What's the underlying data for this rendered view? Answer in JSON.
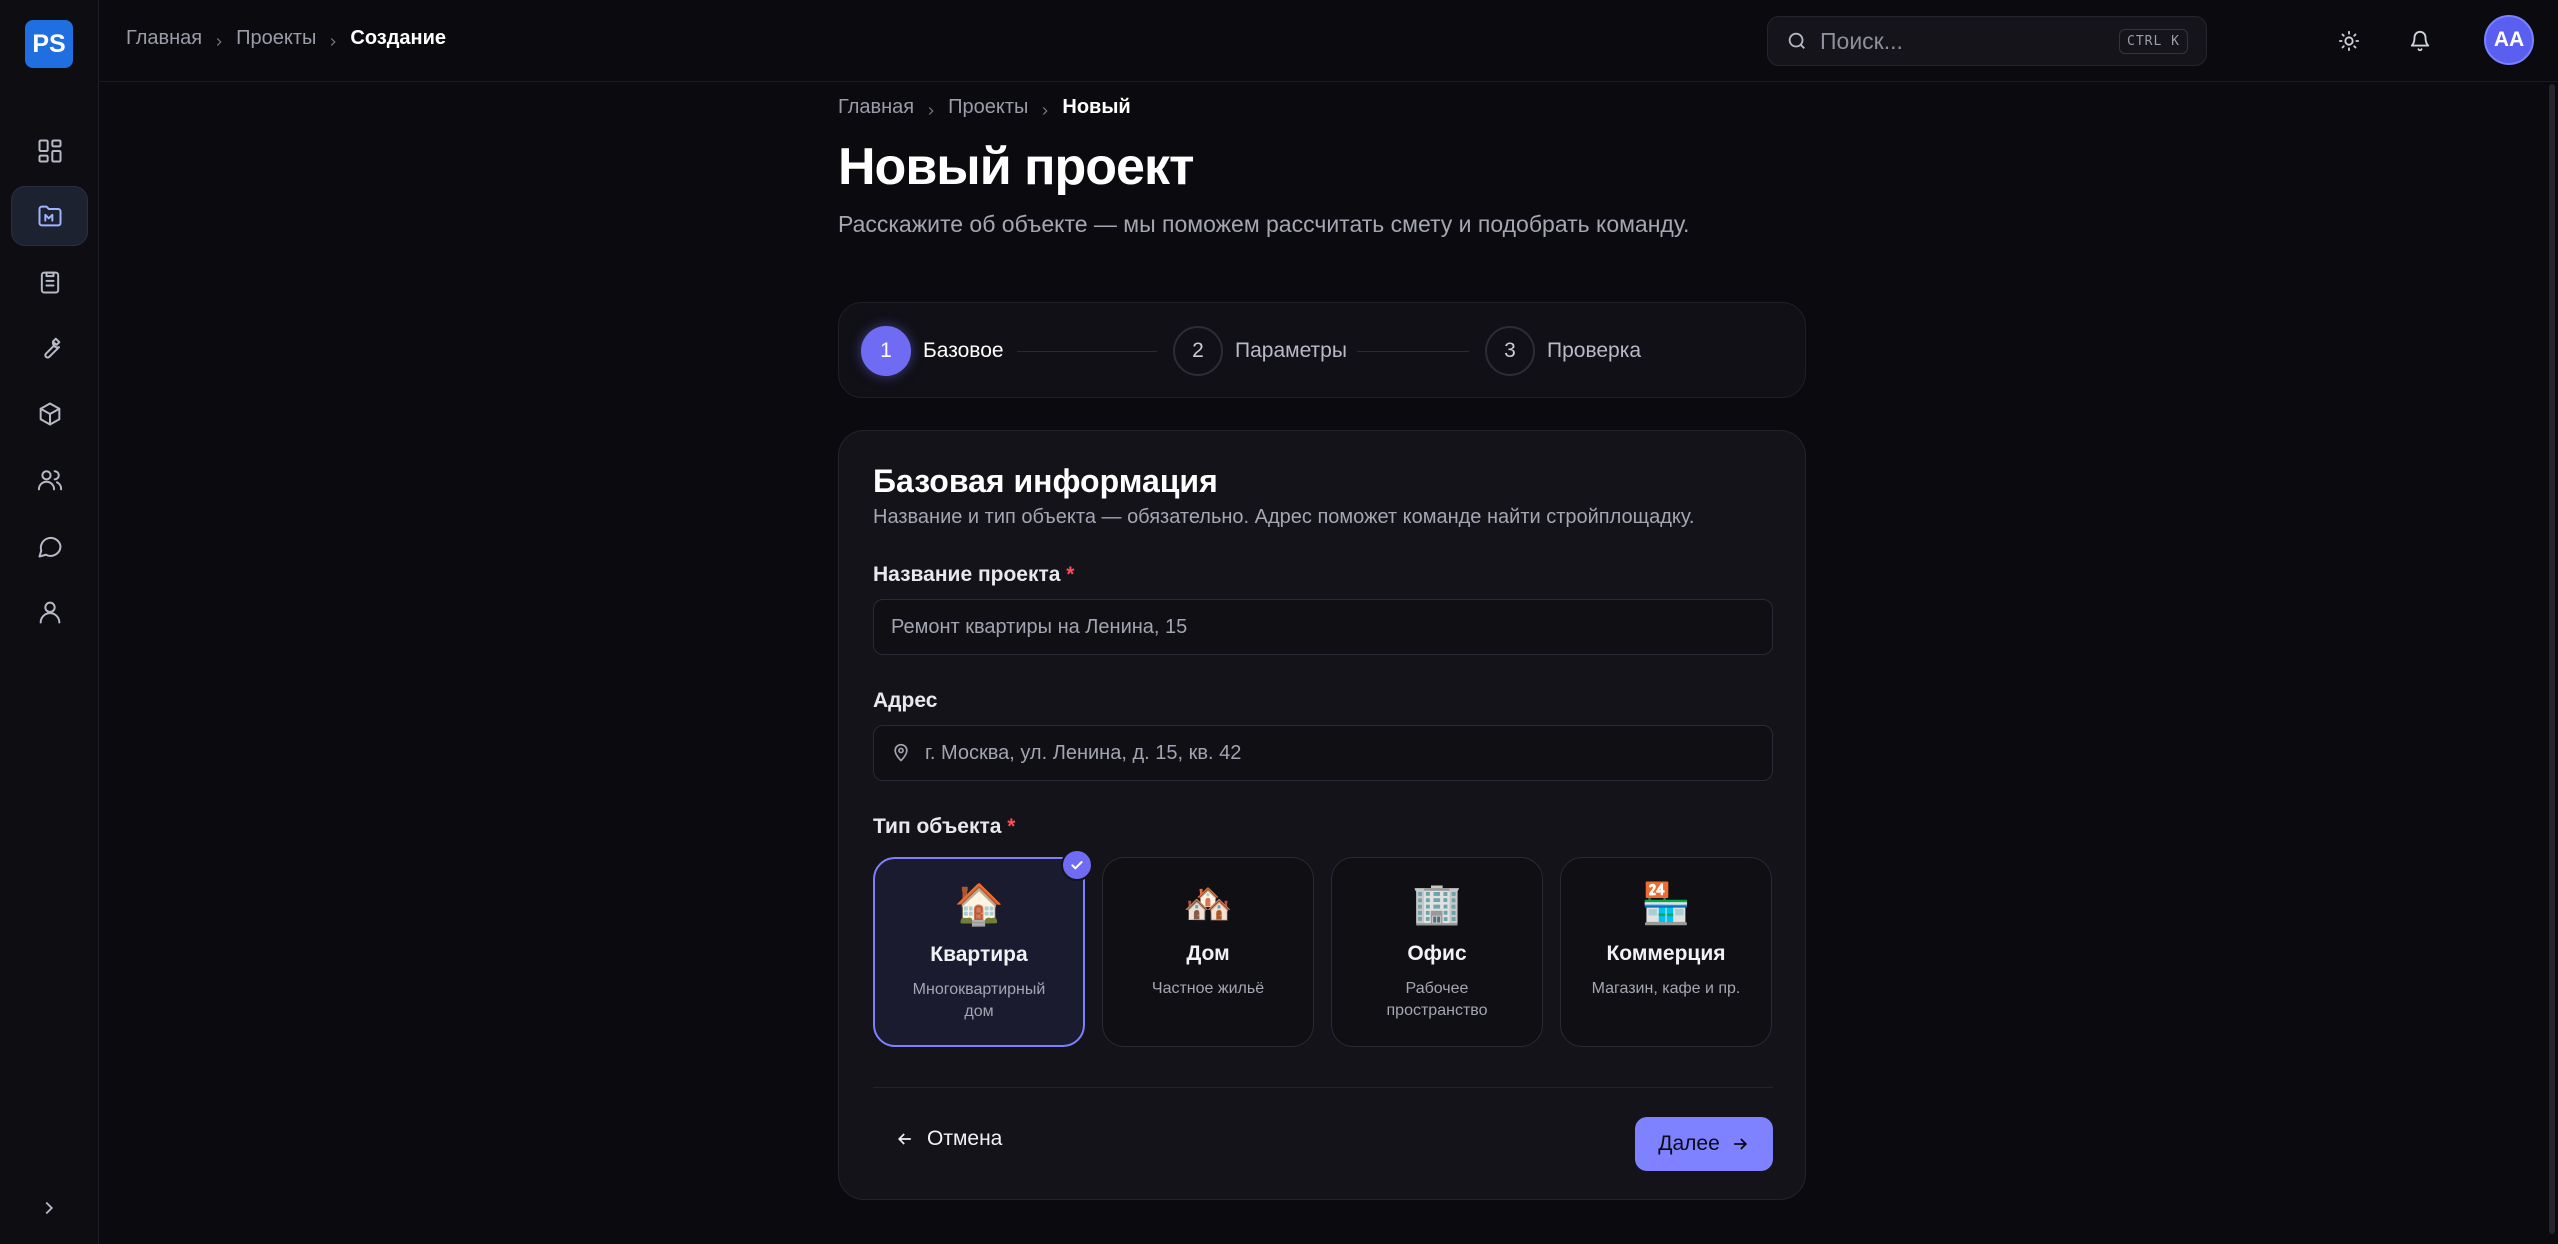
{
  "app": {
    "logo_text": "PS"
  },
  "topbar": {
    "breadcrumb": [
      "Главная",
      "Проекты",
      "Создание"
    ],
    "search_placeholder": "Поиск...",
    "search_shortcut": "CTRL K",
    "avatar_initials": "AA"
  },
  "sidebar": {
    "items": [
      {
        "icon": "dashboard-icon"
      },
      {
        "icon": "projects-icon",
        "active": true
      },
      {
        "icon": "clipboard-icon"
      },
      {
        "icon": "wrench-icon"
      },
      {
        "icon": "box-icon"
      },
      {
        "icon": "users-icon"
      },
      {
        "icon": "chat-icon"
      },
      {
        "icon": "user-icon"
      }
    ],
    "expand_icon": "chevron-right-icon"
  },
  "page": {
    "breadcrumb": [
      "Главная",
      "Проекты",
      "Новый"
    ],
    "title": "Новый проект",
    "subtitle": "Расскажите об объекте — мы поможем рассчитать смету и подобрать команду."
  },
  "stepper": {
    "steps": [
      {
        "num": "1",
        "label": "Базовое",
        "active": true
      },
      {
        "num": "2",
        "label": "Параметры"
      },
      {
        "num": "3",
        "label": "Проверка"
      }
    ]
  },
  "form": {
    "title": "Базовая информация",
    "subtitle": "Название и тип объекта — обязательно. Адрес поможет команде найти стройплощадку.",
    "name_label": "Название проекта",
    "name_placeholder": "Ремонт квартиры на Ленина, 15",
    "address_label": "Адрес",
    "address_placeholder": "г. Москва, ул. Ленина, д. 15, кв. 42",
    "type_label": "Тип объекта",
    "required_mark": "*",
    "types": [
      {
        "emoji": "🏠",
        "name": "Квартира",
        "desc": "Многоквартирный дом",
        "selected": true
      },
      {
        "emoji": "🏘️",
        "name": "Дом",
        "desc": "Частное жильё"
      },
      {
        "emoji": "🏢",
        "name": "Офис",
        "desc": "Рабочее пространство"
      },
      {
        "emoji": "🏪",
        "name": "Коммерция",
        "desc": "Магазин, кафе и пр."
      }
    ],
    "cancel_label": "Отмена",
    "next_label": "Далее"
  },
  "colors": {
    "accent": "#6f6cf3",
    "button": "#7f82ff",
    "logo": "#1f6fe0",
    "required": "#ff4d5e"
  }
}
